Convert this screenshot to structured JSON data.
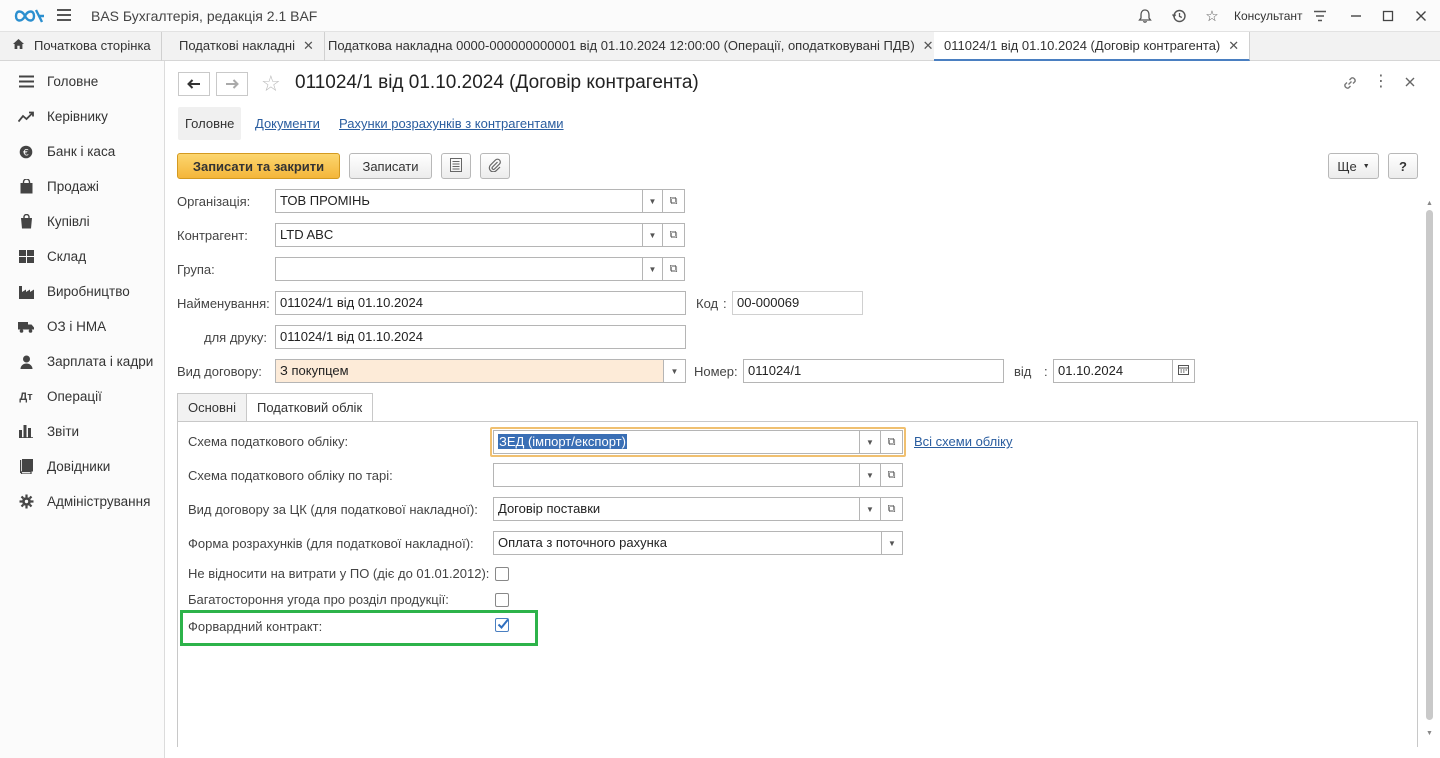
{
  "titlebar": {
    "app_title": "BAS Бухгалтерія, редакція 2.1 BAF",
    "user": "Консультант",
    "icons": [
      "bell-icon",
      "history-icon",
      "star-icon",
      "settings-icon",
      "minimize-icon",
      "maximize-icon",
      "close-icon"
    ]
  },
  "tabs": [
    {
      "label": "Початкова сторінка"
    },
    {
      "label": "Податкові накладні"
    },
    {
      "label": "Податкова накладна 0000-000000000001 від 01.10.2024 12:00:00 (Операції, оподатковувані ПДВ)"
    },
    {
      "label": "011024/1 від 01.10.2024 (Договір контрагента)"
    }
  ],
  "sidebar": {
    "items": [
      {
        "label": "Головне",
        "icon": "list-icon"
      },
      {
        "label": "Керівнику",
        "icon": "trend-icon"
      },
      {
        "label": "Банк і каса",
        "icon": "coin-icon"
      },
      {
        "label": "Продажі",
        "icon": "bag-icon"
      },
      {
        "label": "Купівлі",
        "icon": "cart-icon"
      },
      {
        "label": "Склад",
        "icon": "warehouse-icon"
      },
      {
        "label": "Виробництво",
        "icon": "factory-icon"
      },
      {
        "label": "ОЗ і НМА",
        "icon": "truck-icon"
      },
      {
        "label": "Зарплата і кадри",
        "icon": "person-icon"
      },
      {
        "label": "Операції",
        "icon": "operations-icon"
      },
      {
        "label": "Звіти",
        "icon": "chart-icon"
      },
      {
        "label": "Довідники",
        "icon": "book-icon"
      },
      {
        "label": "Адміністрування",
        "icon": "gear-icon"
      }
    ]
  },
  "form": {
    "title": "011024/1 від 01.10.2024 (Договір контрагента)",
    "subnav": {
      "main": "Головне",
      "documents": "Документи",
      "accounts": "Рахунки розрахунків з контрагентами"
    },
    "toolbar": {
      "save_close": "Записати та закрити",
      "save": "Записати",
      "more": "Ще",
      "help": "?"
    },
    "organization": {
      "label": "Організація:",
      "value": "ТОВ ПРОМІНЬ"
    },
    "counterparty": {
      "label": "Контрагент:",
      "value": "LTD ABC"
    },
    "group": {
      "label": "Група:",
      "value": ""
    },
    "name": {
      "label": "Найменування:",
      "value": "011024/1 від 01.10.2024"
    },
    "code": {
      "label": "Код",
      "sep": ":",
      "value": "00-000069"
    },
    "print_name": {
      "label": "для друку:",
      "value": "011024/1 від 01.10.2024"
    },
    "contract_type": {
      "label": "Вид договору:",
      "value": "З покупцем"
    },
    "number": {
      "label": "Номер:",
      "value": "011024/1"
    },
    "date": {
      "label": "від",
      "sep": ":",
      "value": "01.10.2024"
    },
    "inner_tabs": {
      "main": "Основні",
      "tax": "Податковий облік"
    },
    "tax": {
      "scheme": {
        "label": "Схема податкового обліку:",
        "value": "ЗЕД (імпорт/експорт)",
        "link": "Всі схеми обліку"
      },
      "scheme_tare": {
        "label": "Схема податкового обліку по тарі:",
        "value": ""
      },
      "contract_kind": {
        "label": "Вид договору за ЦК (для податкової накладної):",
        "value": "Договір поставки"
      },
      "payment_form": {
        "label": "Форма розрахунків (для податкової накладної):",
        "value": "Оплата з поточного рахунка"
      },
      "no_expense": {
        "label": "Не відносити на витрати у ПО (діє до 01.01.2012):",
        "checked": false
      },
      "multilateral": {
        "label": "Багатостороння угода про розділ продукції:",
        "checked": false
      },
      "forward": {
        "label": "Форвардний контракт:",
        "checked": true
      }
    }
  },
  "colors": {
    "accent": "#4a7fc1",
    "primary_button": "#f4b63a",
    "highlight": "#2db34a",
    "required_bg": "#fdebd8"
  }
}
